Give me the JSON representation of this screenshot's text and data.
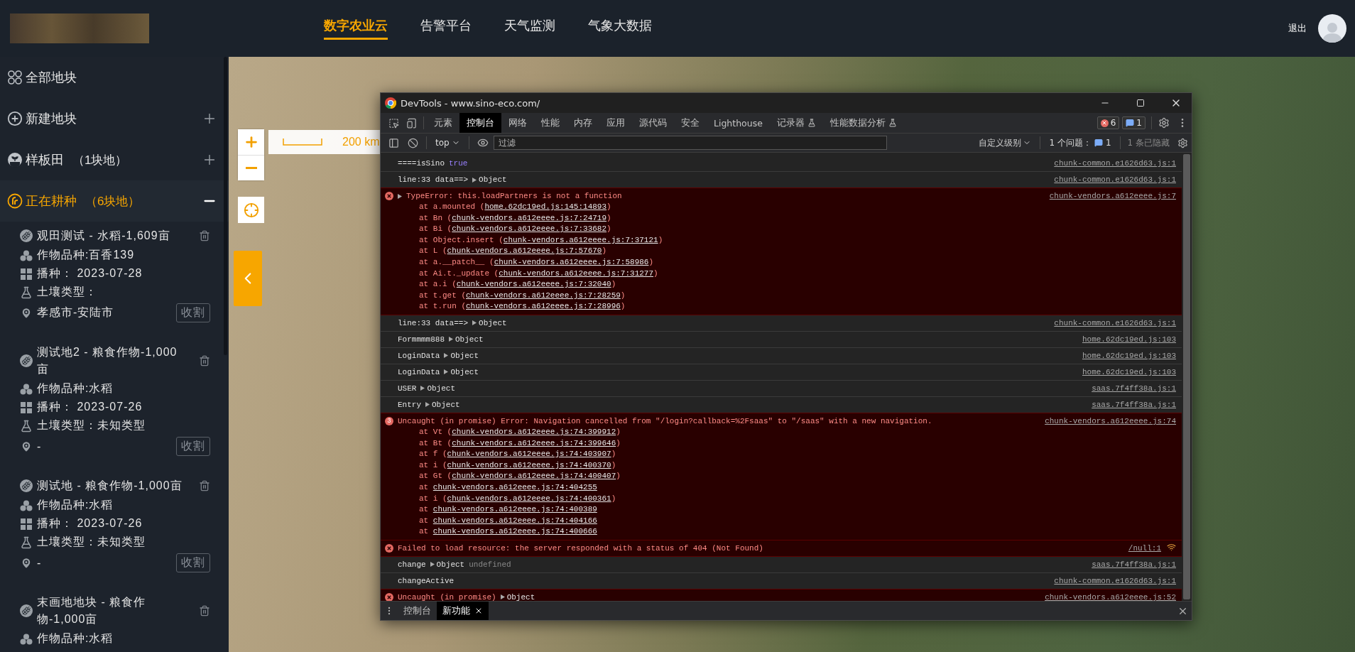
{
  "header": {
    "nav": [
      {
        "label": "数字农业云",
        "selected": true
      },
      {
        "label": "告警平台",
        "selected": false
      },
      {
        "label": "天气监测",
        "selected": false
      },
      {
        "label": "气象大数据",
        "selected": false
      }
    ],
    "logout": "退出"
  },
  "sidebar": {
    "sections": [
      {
        "kind": "all",
        "label": "全部地块",
        "expanded": false
      },
      {
        "kind": "new",
        "label": "新建地块",
        "addable": true,
        "expanded": false
      },
      {
        "kind": "sample",
        "label": "样板田",
        "count": "（1块地）",
        "addable": true,
        "expanded": false
      },
      {
        "kind": "planting",
        "label": "正在耕种",
        "count": "（6块地）",
        "expanded": true,
        "plots": [
          {
            "title": "观田测试 - 水稻-1,609亩",
            "variety": "作物品种:百香139",
            "sowing": "播种： 2023-07-28",
            "soil": "土壤类型：",
            "location": "孝感市-安陆市",
            "action": "收割"
          },
          {
            "title": "测试地2 - 粮食作物-1,000亩",
            "variety": "作物品种:水稻",
            "sowing": "播种： 2023-07-26",
            "soil": "土壤类型：未知类型",
            "location": "-",
            "action": "收割"
          },
          {
            "title": "测试地 - 粮食作物-1,000亩",
            "variety": "作物品种:水稻",
            "sowing": "播种： 2023-07-26",
            "soil": "土壤类型：未知类型",
            "location": "-",
            "action": "收割"
          },
          {
            "title": "末画地地块 - 粮食作物-1,000亩",
            "variety": "作物品种:水稻"
          }
        ]
      }
    ]
  },
  "map": {
    "scale": "200 km"
  },
  "devtools": {
    "title": "DevTools - www.sino-eco.com/",
    "tabs": [
      {
        "label": "元素",
        "selected": false
      },
      {
        "label": "控制台",
        "selected": true
      },
      {
        "label": "网络",
        "selected": false
      },
      {
        "label": "性能",
        "selected": false
      },
      {
        "label": "内存",
        "selected": false
      },
      {
        "label": "应用",
        "selected": false
      },
      {
        "label": "源代码",
        "selected": false
      },
      {
        "label": "安全",
        "selected": false
      },
      {
        "label": "Lighthouse",
        "selected": false
      },
      {
        "label": "记录器",
        "selected": false,
        "experimental": true
      },
      {
        "label": "性能数据分析",
        "selected": false,
        "experimental": true
      }
    ],
    "error_count": "6",
    "message_count": "1",
    "toolbar": {
      "context": "top",
      "filter_placeholder": "过滤",
      "levels": "自定义级别",
      "issues": "1 个问题：",
      "issues_count": "1",
      "hidden": "1 条已隐藏"
    },
    "messages": [
      {
        "kind": "log",
        "text": "====isSino",
        "value": {
          "kind": "bool",
          "text": "true"
        },
        "source": "chunk-common.e1626d63.js:1"
      },
      {
        "kind": "log",
        "text": "line:33 data==>",
        "value": {
          "kind": "object",
          "text": "Object"
        },
        "source": "chunk-common.e1626d63.js:1"
      },
      {
        "kind": "error",
        "expandable": true,
        "text": "TypeError: this.loadPartners is not a function",
        "source": "chunk-vendors.a612eeee.js:7",
        "stack": [
          {
            "before": "at a.mounted (",
            "link": "home.62dc19ed.js:145:14893",
            "after": ")"
          },
          {
            "before": "at Bn (",
            "link": "chunk-vendors.a612eeee.js:7:24719",
            "after": ")"
          },
          {
            "before": "at Bi (",
            "link": "chunk-vendors.a612eeee.js:7:33682",
            "after": ")"
          },
          {
            "before": "at Object.insert (",
            "link": "chunk-vendors.a612eeee.js:7:37121",
            "after": ")"
          },
          {
            "before": "at L (",
            "link": "chunk-vendors.a612eeee.js:7:57670",
            "after": ")"
          },
          {
            "before": "at a.__patch__ (",
            "link": "chunk-vendors.a612eeee.js:7:58986",
            "after": ")"
          },
          {
            "before": "at Ai.t._update (",
            "link": "chunk-vendors.a612eeee.js:7:31277",
            "after": ")"
          },
          {
            "before": "at a.i (",
            "link": "chunk-vendors.a612eeee.js:7:32040",
            "after": ")"
          },
          {
            "before": "at t.get (",
            "link": "chunk-vendors.a612eeee.js:7:28259",
            "after": ")"
          },
          {
            "before": "at t.run (",
            "link": "chunk-vendors.a612eeee.js:7:28996",
            "after": ")"
          }
        ]
      },
      {
        "kind": "log",
        "text": "line:33 data==>",
        "value": {
          "kind": "object",
          "text": "Object"
        },
        "source": "chunk-common.e1626d63.js:1"
      },
      {
        "kind": "log",
        "text": "Formmmm888",
        "value": {
          "kind": "object",
          "text": "Object"
        },
        "source": "home.62dc19ed.js:103"
      },
      {
        "kind": "log",
        "text": "LoginData",
        "value": {
          "kind": "object",
          "text": "Object"
        },
        "source": "home.62dc19ed.js:103"
      },
      {
        "kind": "log",
        "text": "LoginData",
        "value": {
          "kind": "object",
          "text": "Object"
        },
        "source": "home.62dc19ed.js:103"
      },
      {
        "kind": "log",
        "text": "USER",
        "value": {
          "kind": "object",
          "text": "Object"
        },
        "source": "saas.7f4ff38a.js:1"
      },
      {
        "kind": "log",
        "text": "Entry",
        "value": {
          "kind": "object",
          "text": "Object"
        },
        "source": "saas.7f4ff38a.js:1"
      },
      {
        "kind": "error",
        "repeat": "3",
        "text": "Uncaught (in promise) Error: Navigation cancelled from \"/login?callback=%2Fsaas\" to \"/saas\" with a new navigation.",
        "source": "chunk-vendors.a612eeee.js:74",
        "stack": [
          {
            "before": "at Vt (",
            "link": "chunk-vendors.a612eeee.js:74:399912",
            "after": ")"
          },
          {
            "before": "at Bt (",
            "link": "chunk-vendors.a612eeee.js:74:399646",
            "after": ")"
          },
          {
            "before": "at f (",
            "link": "chunk-vendors.a612eeee.js:74:403907",
            "after": ")"
          },
          {
            "before": "at i (",
            "link": "chunk-vendors.a612eeee.js:74:400370",
            "after": ")"
          },
          {
            "before": "at Gt (",
            "link": "chunk-vendors.a612eeee.js:74:400407",
            "after": ")"
          },
          {
            "before": "at ",
            "link": "chunk-vendors.a612eeee.js:74:404255"
          },
          {
            "before": "at i (",
            "link": "chunk-vendors.a612eeee.js:74:400361",
            "after": ")"
          },
          {
            "before": "at ",
            "link": "chunk-vendors.a612eeee.js:74:400389"
          },
          {
            "before": "at ",
            "link": "chunk-vendors.a612eeee.js:74:404166"
          },
          {
            "before": "at ",
            "link": "chunk-vendors.a612eeee.js:74:400666"
          }
        ]
      },
      {
        "kind": "error",
        "text": "Failed to load resource: the server responded with a status of 404 (Not Found)",
        "source": "/null:1",
        "network": true
      },
      {
        "kind": "log",
        "text": "change",
        "value": {
          "kind": "object",
          "text": "Object"
        },
        "extra": "undefined",
        "source": "saas.7f4ff38a.js:1"
      },
      {
        "kind": "log",
        "text": "changeActive",
        "source": "chunk-common.e1626d63.js:1"
      },
      {
        "kind": "error",
        "text": "Uncaught (in promise)",
        "value": {
          "kind": "object",
          "text": "Object"
        },
        "source": "chunk-vendors.a612eeee.js:52"
      }
    ],
    "drawer_tabs": [
      {
        "label": "控制台",
        "selected": false
      },
      {
        "label": "新功能",
        "selected": true,
        "closable": true
      }
    ]
  }
}
